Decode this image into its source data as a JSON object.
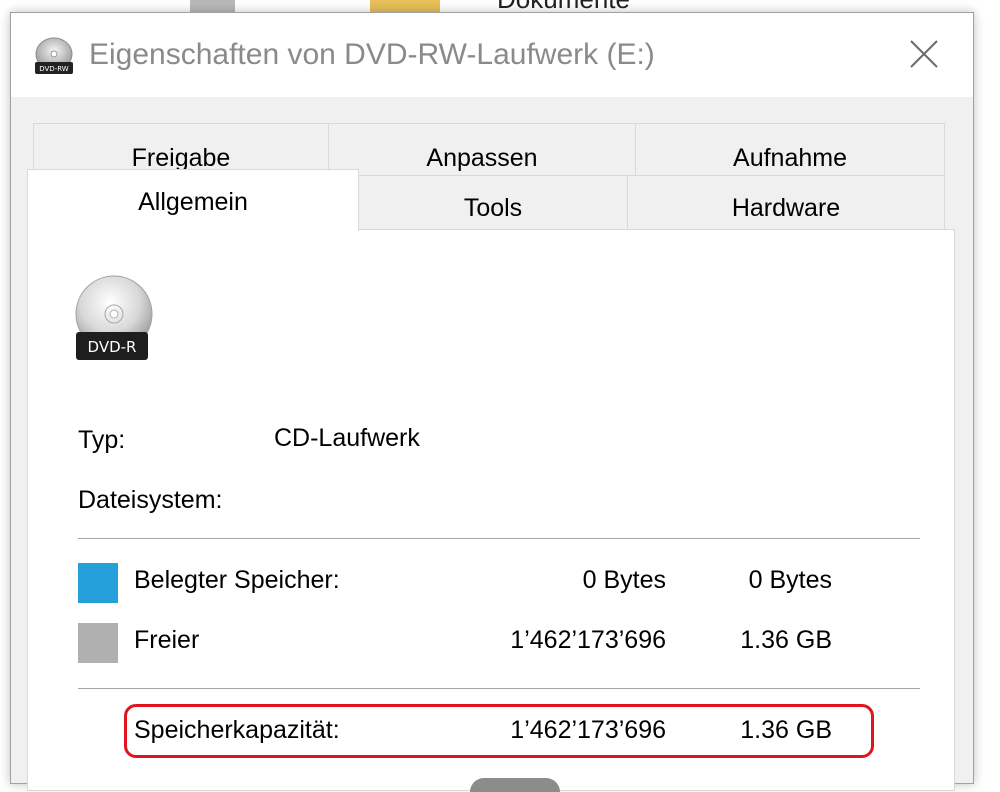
{
  "background": {
    "behind_text": "Dokumente"
  },
  "window": {
    "title": "Eigenschaften von DVD-RW-Laufwerk (E:)",
    "title_icon_label": "DVD-RW",
    "close_symbol": "✕"
  },
  "tabs": {
    "row1": [
      {
        "label": "Freigabe"
      },
      {
        "label": "Anpassen"
      },
      {
        "label": "Aufnahme"
      }
    ],
    "row2": [
      {
        "label": "Allgemein",
        "active": true
      },
      {
        "label": "Tools"
      },
      {
        "label": "Hardware"
      }
    ]
  },
  "general": {
    "drive_icon_label": "DVD-R",
    "type_label": "Typ:",
    "type_value": "CD-Laufwerk",
    "filesystem_label": "Dateisystem:",
    "filesystem_value": "",
    "used": {
      "label": "Belegter Speicher:",
      "bytes": "0 Bytes",
      "human": "0 Bytes",
      "color": "#26a0da"
    },
    "free": {
      "label": "Freier",
      "bytes": "1’462’173’696",
      "human": "1.36 GB",
      "color": "#b0b0b0"
    },
    "capacity": {
      "label": "Speicherkapazität:",
      "bytes": "1’462’173’696",
      "human": "1.36 GB"
    }
  },
  "colors": {
    "highlight": "#e0141e"
  }
}
